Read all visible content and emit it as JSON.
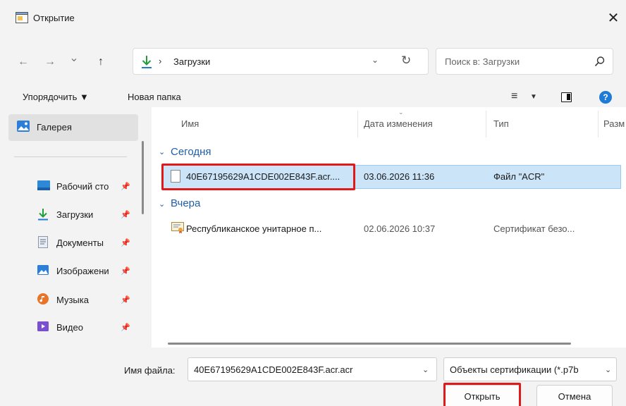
{
  "window": {
    "title": "Открытие",
    "close_glyph": "✕"
  },
  "nav": {
    "back_glyph": "←",
    "forward_glyph": "→",
    "recent_glyph": "⌄",
    "up_glyph": "↑",
    "address_separator": "›",
    "address_text": "Загрузки",
    "address_dropdown_glyph": "⌄",
    "refresh_glyph": "↻",
    "search_placeholder": "Поиск в: Загрузки"
  },
  "toolbar": {
    "organize_label": "Упорядочить ▼",
    "new_folder_label": "Новая папка",
    "view_glyph": "≡",
    "view_chevron": "▼",
    "help_glyph": "?"
  },
  "sidebar": {
    "items": [
      {
        "label": "Галерея",
        "icon": "gallery-icon",
        "pinned": false,
        "selected": true
      },
      {
        "label": "Рабочий сто",
        "icon": "desktop-icon",
        "pinned": true
      },
      {
        "label": "Загрузки",
        "icon": "downloads-icon",
        "pinned": true
      },
      {
        "label": "Документы",
        "icon": "documents-icon",
        "pinned": true
      },
      {
        "label": "Изображени",
        "icon": "pictures-icon",
        "pinned": true
      },
      {
        "label": "Музыка",
        "icon": "music-icon",
        "pinned": true
      },
      {
        "label": "Видео",
        "icon": "video-icon",
        "pinned": true
      }
    ],
    "pin_glyph": "📌"
  },
  "columns": {
    "name": "Имя",
    "date": "Дата изменения",
    "type": "Тип",
    "size": "Разм",
    "sort_glyph": "⌄"
  },
  "groups": [
    {
      "label": "Сегодня",
      "chevron": "⌄",
      "files": [
        {
          "name": "40E67195629A1CDE002E843F.acr....",
          "date": "03.06.2026 11:36",
          "type": "Файл \"ACR\"",
          "icon": "file-icon",
          "selected": true
        }
      ]
    },
    {
      "label": "Вчера",
      "chevron": "⌄",
      "files": [
        {
          "name": "Республиканское унитарное п...",
          "date": "02.06.2026 10:37",
          "type": "Сертификат безо...",
          "icon": "certificate-icon",
          "selected": false
        }
      ]
    }
  ],
  "bottom": {
    "filename_label": "Имя файла:",
    "filename_value": "40E67195629A1CDE002E843F.acr.acr",
    "filename_chevron": "⌄",
    "filetype_value": "Объекты сертификации (*.p7b",
    "filetype_chevron": "⌄",
    "open_label": "Открыть",
    "cancel_label": "Отмена"
  },
  "colors": {
    "accent": "#1e7bd6",
    "selection_bg": "#cce4f7",
    "highlight_red": "#e01a1a",
    "group_blue": "#1f5ea8"
  }
}
